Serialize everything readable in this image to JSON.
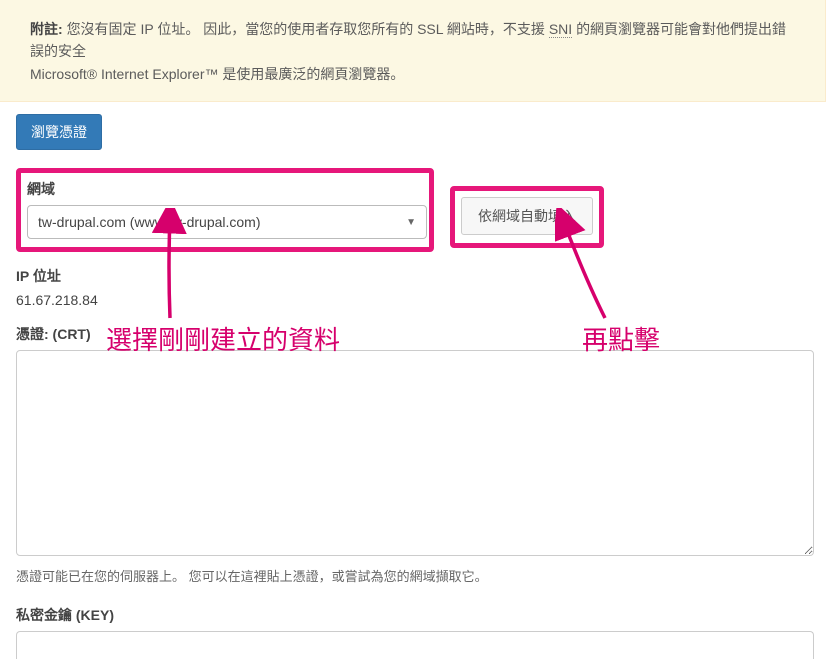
{
  "notice": {
    "prefix": "附註:",
    "line1a": " 您沒有固定 IP 位址。 因此，當您的使用者存取您所有的 SSL 網站時，不支援 ",
    "sni": "SNI",
    "line1b": " 的網頁瀏覽器可能會對他們提出錯誤的安全",
    "line2": "Microsoft® Internet Explorer™ 是使用最廣泛的網頁瀏覽器。"
  },
  "browse_button": "瀏覽憑證",
  "domain": {
    "label": "網域",
    "selected": "tw-drupal.com   (www.tw-drupal.com)"
  },
  "autofill_button": "依網域自動填入",
  "ip": {
    "label": "IP 位址",
    "value": "61.67.218.84"
  },
  "cert": {
    "label": "憑證: (CRT)",
    "value": "",
    "help": "憑證可能已在您的伺服器上。 您可以在這裡貼上憑證，或嘗試為您的網域擷取它。"
  },
  "key": {
    "label": "私密金鑰 (KEY)",
    "value": ""
  },
  "annotations": {
    "left": "選擇剛剛建立的資料",
    "right": "再點擊"
  }
}
